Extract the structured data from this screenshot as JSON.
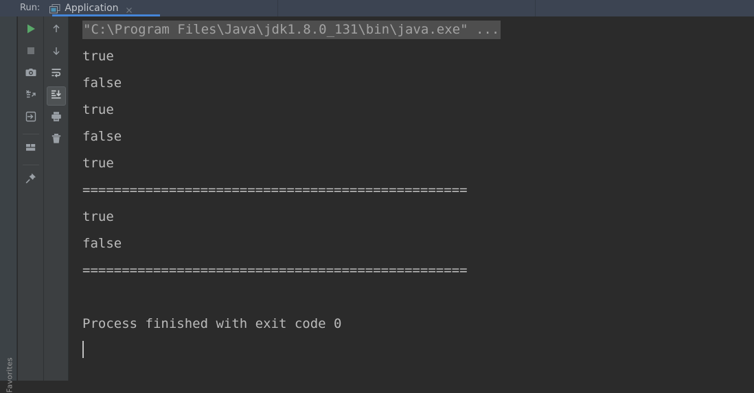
{
  "header": {
    "run_label": "Run:",
    "tab": {
      "title": "Application",
      "icon": "application-window-icon",
      "close_icon": "close-icon",
      "active": true,
      "underline_color": "#4585d8"
    },
    "background_color": "#3c4452"
  },
  "left_strip": {
    "label": "Favorites"
  },
  "toolbar_primary": {
    "buttons": [
      {
        "name": "rerun-button",
        "icon": "play-icon",
        "color": "#59a869"
      },
      {
        "name": "stop-button",
        "icon": "stop-square-icon",
        "color": "#6e7275"
      },
      {
        "name": "screenshot-button",
        "icon": "camera-icon",
        "color": "#9aa0a6"
      },
      {
        "name": "rerun-failed-tests-button",
        "icon": "rerun-failed-icon",
        "color": "#9aa0a6"
      },
      {
        "name": "dump-threads-button",
        "icon": "arrow-into-box-icon",
        "color": "#9aa0a6"
      },
      {
        "name": "layout-settings-button",
        "icon": "layout-icon",
        "color": "#9aa0a6"
      },
      {
        "name": "pin-tab-button",
        "icon": "pin-icon",
        "color": "#9aa0a6"
      }
    ]
  },
  "toolbar_secondary": {
    "buttons": [
      {
        "name": "up-the-stack-trace-button",
        "icon": "arrow-up-icon",
        "selected": false
      },
      {
        "name": "down-the-stack-trace-button",
        "icon": "arrow-down-icon",
        "selected": false
      },
      {
        "name": "soft-wrap-button",
        "icon": "soft-wrap-icon",
        "selected": false
      },
      {
        "name": "scroll-to-end-button",
        "icon": "scroll-to-end-icon",
        "selected": true
      },
      {
        "name": "print-button",
        "icon": "printer-icon",
        "selected": false
      },
      {
        "name": "clear-all-button",
        "icon": "trash-icon",
        "selected": false
      }
    ]
  },
  "console": {
    "background_color": "#2b2b2b",
    "text_color": "#bbbbbb",
    "command_highlight_color": "#4e4e4e",
    "lines": [
      {
        "type": "command",
        "text": "\"C:\\Program Files\\Java\\jdk1.8.0_131\\bin\\java.exe\" ..."
      },
      {
        "type": "output",
        "text": "true"
      },
      {
        "type": "output",
        "text": "false"
      },
      {
        "type": "output",
        "text": "true"
      },
      {
        "type": "output",
        "text": "false"
      },
      {
        "type": "output",
        "text": "true"
      },
      {
        "type": "output",
        "text": "================================================="
      },
      {
        "type": "output",
        "text": "true"
      },
      {
        "type": "output",
        "text": "false"
      },
      {
        "type": "output",
        "text": "================================================="
      },
      {
        "type": "blank",
        "text": ""
      },
      {
        "type": "output",
        "text": "Process finished with exit code 0"
      },
      {
        "type": "caret",
        "text": ""
      }
    ]
  }
}
